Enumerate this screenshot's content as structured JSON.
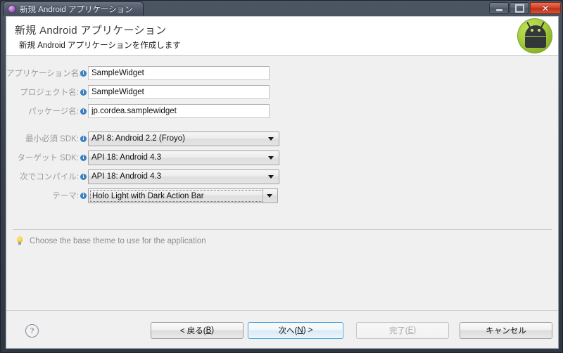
{
  "window": {
    "title": "新規 Android アプリケーション",
    "title_icon": "sphere-icon",
    "controls": {
      "minimize": "minimize-icon",
      "maximize": "maximize-icon",
      "close": "✕"
    }
  },
  "header": {
    "title": "新規 Android アプリケーション",
    "subtitle": "新規 Android アプリケーションを作成します",
    "logo": "android-robot-logo"
  },
  "form": {
    "fields": [
      {
        "label": "アプリケーション名:",
        "type": "text",
        "value": "SampleWidget",
        "name": "application-name"
      },
      {
        "label": "プロジェクト名:",
        "type": "text",
        "value": "SampleWidget",
        "name": "project-name"
      },
      {
        "label": "パッケージ名:",
        "type": "text",
        "value": "jp.cordea.samplewidget",
        "name": "package-name"
      },
      {
        "label": "最小必須 SDK:",
        "type": "combo",
        "value": "API 8: Android 2.2 (Froyo)",
        "name": "minimum-required-sdk"
      },
      {
        "label": "ターゲット SDK:",
        "type": "combo",
        "value": "API 18: Android 4.3",
        "name": "target-sdk"
      },
      {
        "label": "次でコンパイル:",
        "type": "combo",
        "value": "API 18: Android 4.3",
        "name": "compile-with"
      },
      {
        "label": "テーマ:",
        "type": "combo-focused",
        "value": "Holo Light with Dark Action Bar",
        "name": "theme"
      }
    ]
  },
  "hint": {
    "icon": "lightbulb-icon",
    "text": "Choose the base theme to use for the application"
  },
  "footer": {
    "help": "?",
    "buttons": [
      {
        "label_pre": "< 戻る(",
        "mnemonic": "B",
        "label_post": ")",
        "name": "back-button",
        "state": "normal"
      },
      {
        "label_pre": "次へ(",
        "mnemonic": "N",
        "label_post": ") >",
        "name": "next-button",
        "state": "primary"
      },
      {
        "label_pre": "完了(",
        "mnemonic": "E",
        "label_post": ")",
        "name": "finish-button",
        "state": "disabled"
      },
      {
        "label_pre": "キャンセル",
        "mnemonic": "",
        "label_post": "",
        "name": "cancel-button",
        "state": "normal"
      }
    ]
  },
  "colors": {
    "accent": "#3c9fdc",
    "android_green": "#a4ce3d",
    "title_chrome": "#4c5562"
  }
}
